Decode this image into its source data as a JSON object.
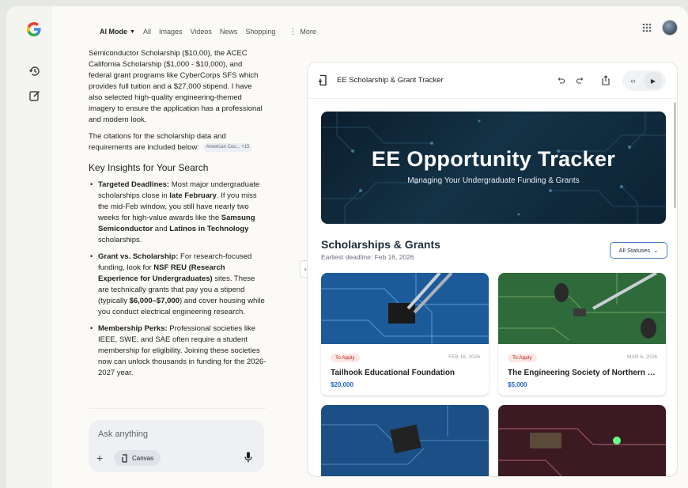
{
  "nav": {
    "ai_mode": "AI Mode",
    "tabs": [
      "All",
      "Images",
      "Videos",
      "News",
      "Shopping"
    ],
    "more": "More"
  },
  "chat": {
    "para1": "Semiconductor Scholarship ($10,00), the ACEC California Scholarship ($1,000 - $10,000), and federal grant programs like CyberCorps SFS which provides full tuition and a $27,000 stipend. I have also selected high-quality engineering-themed imagery to ensure the application has a professional and modern look.",
    "para2": "The citations for the scholarship data and requirements are included below:",
    "citation_chip": "American Cou... +15",
    "heading": "Key Insights for Your Search",
    "bullets": [
      {
        "label": "Targeted Deadlines:",
        "t1": " Most major undergraduate scholarships close in ",
        "b1": "late February",
        "t2": ". If you miss the mid-Feb window, you still have nearly two weeks for high-value awards like the ",
        "b2": "Samsung Semiconductor",
        "t3": " and ",
        "b3": "Latinos in Technology",
        "t4": " scholarships."
      },
      {
        "label": "Grant vs. Scholarship:",
        "t1": " For research-focused funding, look for ",
        "b1": "NSF REU (Research Experience for Undergraduates)",
        "t2": " sites. These are technically grants that pay you a stipend (typically ",
        "b2": "$6,000–$7,000",
        "t3": ") and cover housing while you conduct electrical engineering research."
      },
      {
        "label": "Membership Perks:",
        "t1": " Professional societies like IEEE, SWE, and SAE often require a student membership for eligibility. Joining these societies now can unlock thousands in funding for the 2026-2027 year."
      }
    ]
  },
  "ask": {
    "placeholder": "Ask anything",
    "canvas_label": "Canvas"
  },
  "canvas": {
    "title": "EE Scholarship & Grant Tracker",
    "hero_title": "EE Opportunity Tracker",
    "hero_subtitle": "Managing Your Undergraduate Funding & Grants",
    "section_title": "Scholarships & Grants",
    "section_subtitle": "Earliest deadline: Feb 16, 2026",
    "status_filter": "All Statuses",
    "cards": [
      {
        "badge": "To Apply",
        "date": "FEB 16, 2026",
        "name": "Tailhook Educational Foundation",
        "amount": "$20,000"
      },
      {
        "badge": "To Apply",
        "date": "MAR 6, 2026",
        "name": "The Engineering Society of Northern Michigan",
        "amount": "$5,000"
      }
    ]
  },
  "colors": {
    "accent_blue": "#2563c9",
    "badge_red": "#b3261e",
    "hero_bg": "#0b1d2c"
  }
}
